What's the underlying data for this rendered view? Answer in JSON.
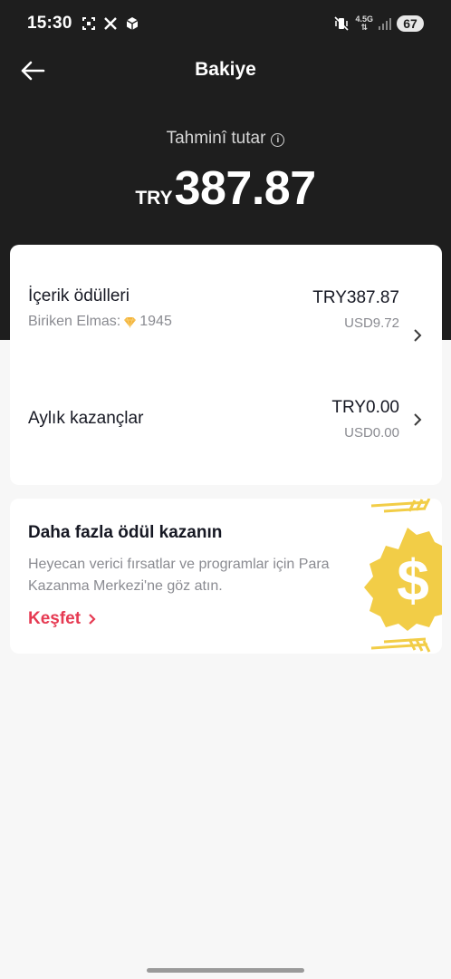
{
  "status_bar": {
    "time": "15:30",
    "icons_left": [
      "screenshot-icon",
      "x-logo-icon",
      "package-icon"
    ],
    "network": "4.5G",
    "battery": "67"
  },
  "header": {
    "title": "Bakiye",
    "back_icon": "arrow-left-icon"
  },
  "balance": {
    "label": "Tahminî tutar",
    "currency": "TRY",
    "amount": "387.87"
  },
  "rewards": [
    {
      "title": "İçerik ödülleri",
      "subtitle_label": "Biriken Elmas:",
      "subtitle_value": "1945",
      "amount": "TRY387.87",
      "usd": "USD9.72"
    },
    {
      "title": "Aylık kazançlar",
      "amount": "TRY0.00",
      "usd": "USD0.00"
    }
  ],
  "promo": {
    "title": "Daha fazla ödül kazanın",
    "description": "Heyecan verici fırsatlar ve programlar için Para Kazanma Merkezi'ne göz atın.",
    "link_label": "Keşfet",
    "link_color": "#e63a52",
    "coin_color": "#f2cd47"
  },
  "colors": {
    "dark_bg": "#1e1e1e",
    "page_bg": "#f7f7f7"
  }
}
